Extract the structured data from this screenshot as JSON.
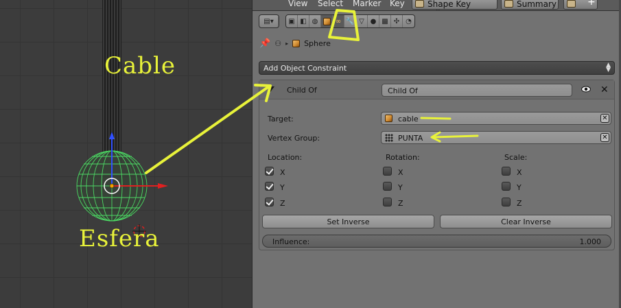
{
  "viewport": {
    "annotations": {
      "cable": "Cable",
      "esfera": "Esfera"
    }
  },
  "topbar": {
    "menus": [
      "View",
      "Select",
      "Marker",
      "Key"
    ],
    "mode_dropdown": "Shape Key Editor",
    "summary_dropdown": "Summary"
  },
  "properties": {
    "breadcrumb": {
      "object": "Sphere"
    },
    "add_constraint": "Add Object Constraint",
    "constraint": {
      "type": "Child Of",
      "name": "Child Of",
      "target_label": "Target:",
      "target_value": "cable",
      "vertex_group_label": "Vertex Group:",
      "vertex_group_value": "PUNTA",
      "location_title": "Location:",
      "rotation_title": "Rotation:",
      "scale_title": "Scale:",
      "axes": [
        "X",
        "Y",
        "Z"
      ],
      "location": [
        true,
        true,
        true
      ],
      "rotation": [
        false,
        false,
        false
      ],
      "scale": [
        false,
        false,
        false
      ],
      "set_inverse": "Set Inverse",
      "clear_inverse": "Clear Inverse",
      "influence_label": "Influence:",
      "influence_value": "1.000"
    }
  },
  "colors": {
    "annotation": "#e8f23a",
    "wire": "#4cd964",
    "panel": "#727272"
  }
}
